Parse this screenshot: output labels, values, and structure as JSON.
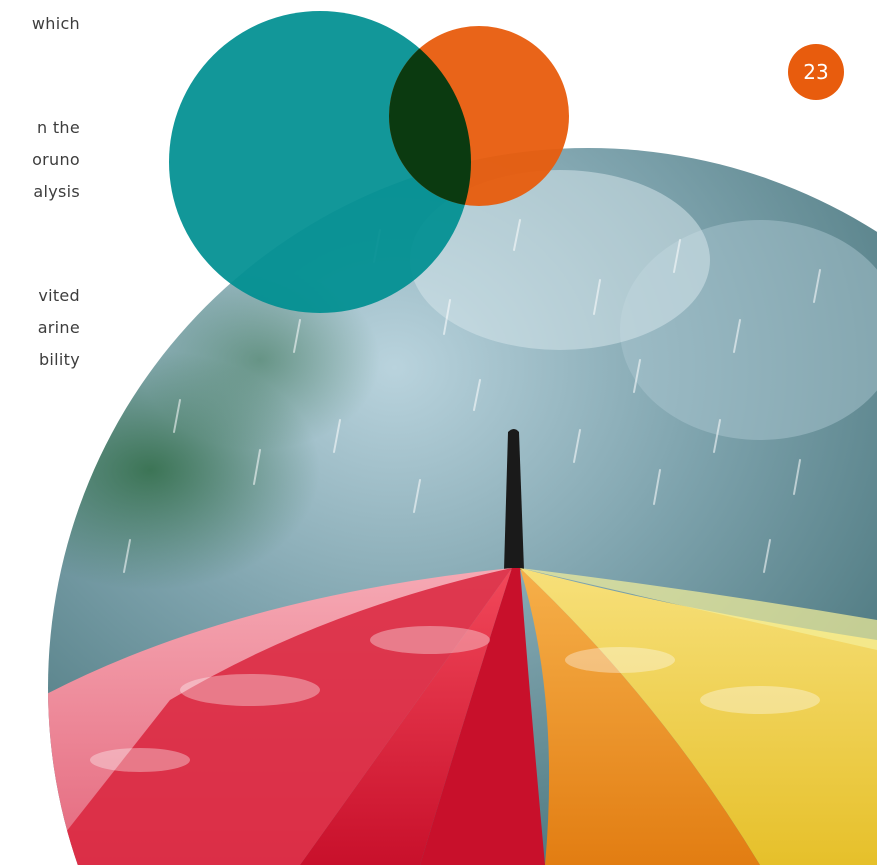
{
  "page": {
    "number": "23"
  },
  "text_fragments": [
    "which",
    "n   the",
    "oruno",
    "alysis",
    "vited",
    "arine",
    "bility"
  ],
  "colors": {
    "teal_circle": "#008f91",
    "orange_circle": "#e85c0d",
    "overlap": "#0b3a10",
    "page_badge": "#e85c0d",
    "body_text": "#3d3d3d"
  },
  "image": {
    "subject": "umbrella-in-rain-photo"
  }
}
